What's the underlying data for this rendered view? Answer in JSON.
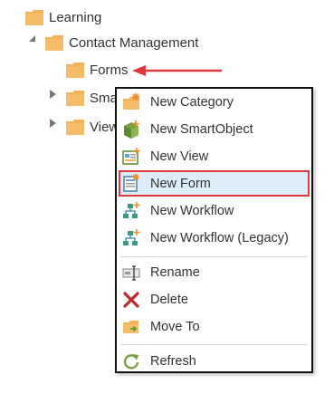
{
  "tree": {
    "items": [
      {
        "label": "Learning",
        "icon": "folder-icon",
        "expander": "none"
      },
      {
        "label": "Contact Management",
        "icon": "folder-icon",
        "expander": "open"
      },
      {
        "label": "Forms",
        "icon": "folder-icon",
        "expander": "none"
      },
      {
        "label": "Sma",
        "icon": "folder-icon",
        "expander": "closed"
      },
      {
        "label": "View",
        "icon": "folder-icon",
        "expander": "closed"
      }
    ]
  },
  "context_menu": {
    "items": [
      {
        "label": "New Category",
        "icon": "new-category-icon"
      },
      {
        "label": "New SmartObject",
        "icon": "new-smartobject-icon"
      },
      {
        "label": "New View",
        "icon": "new-view-icon"
      },
      {
        "label": "New Form",
        "icon": "new-form-icon",
        "highlighted": true
      },
      {
        "label": "New Workflow",
        "icon": "new-workflow-icon"
      },
      {
        "label": "New Workflow (Legacy)",
        "icon": "new-workflow-legacy-icon"
      },
      {
        "label": "Rename",
        "icon": "rename-icon"
      },
      {
        "label": "Delete",
        "icon": "delete-icon"
      },
      {
        "label": "Move To",
        "icon": "move-to-icon"
      },
      {
        "label": "Refresh",
        "icon": "refresh-icon"
      }
    ]
  },
  "colors": {
    "folder": "#f2b35a",
    "highlight_border": "#e0383e",
    "highlight_bg": "#dcecf8",
    "annotation_arrow": "#e0383e"
  }
}
